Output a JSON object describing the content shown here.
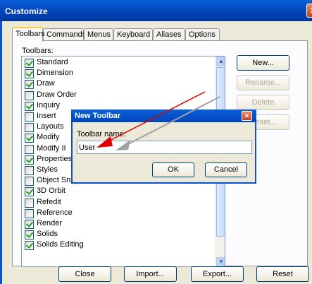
{
  "window": {
    "title": "Customize",
    "close_glyph": "✕"
  },
  "tabs": [
    {
      "label": "Toolbars",
      "active": true
    },
    {
      "label": "Commands",
      "active": false
    },
    {
      "label": "Menus",
      "active": false
    },
    {
      "label": "Keyboard",
      "active": false
    },
    {
      "label": "Aliases",
      "active": false
    },
    {
      "label": "Options",
      "active": false
    }
  ],
  "toolbars_label": "Toolbars:",
  "toolbar_list": [
    {
      "label": "Standard",
      "checked": true
    },
    {
      "label": "Dimension",
      "checked": true
    },
    {
      "label": "Draw",
      "checked": true
    },
    {
      "label": "Draw Order",
      "checked": false
    },
    {
      "label": "Inquiry",
      "checked": true
    },
    {
      "label": "Insert",
      "checked": false
    },
    {
      "label": "Layouts",
      "checked": false
    },
    {
      "label": "Modify",
      "checked": true
    },
    {
      "label": "Modify II",
      "checked": false
    },
    {
      "label": "Properties",
      "checked": true
    },
    {
      "label": "Styles",
      "checked": false
    },
    {
      "label": "Object Snap",
      "checked": false
    },
    {
      "label": "3D Orbit",
      "checked": true
    },
    {
      "label": "Refedit",
      "checked": false
    },
    {
      "label": "Reference",
      "checked": false
    },
    {
      "label": "Render",
      "checked": true
    },
    {
      "label": "Solids",
      "checked": true
    },
    {
      "label": "Solids Editing",
      "checked": true
    }
  ],
  "side_buttons": {
    "new": "New...",
    "rename": "Rename...",
    "delete": "Delete",
    "reset": "Reset..."
  },
  "bottom_buttons": {
    "close": "Close",
    "import": "Import...",
    "export": "Export...",
    "reset": "Reset"
  },
  "new_toolbar_dialog": {
    "title": "New Toolbar",
    "name_label": "Toolbar name:",
    "name_value": "User",
    "ok": "OK",
    "cancel": "Cancel",
    "close_glyph": "✕"
  },
  "colors": {
    "titlebar": "#0a5fd8",
    "dialog_bg": "#ece9d8",
    "check": "#21a121",
    "annotation_arrow_red": "#e00000",
    "annotation_arrow_gray": "#a0a0a0"
  },
  "icons": [
    "close-icon",
    "scroll-up-icon",
    "scroll-down-icon",
    "checkbox-icon"
  ]
}
